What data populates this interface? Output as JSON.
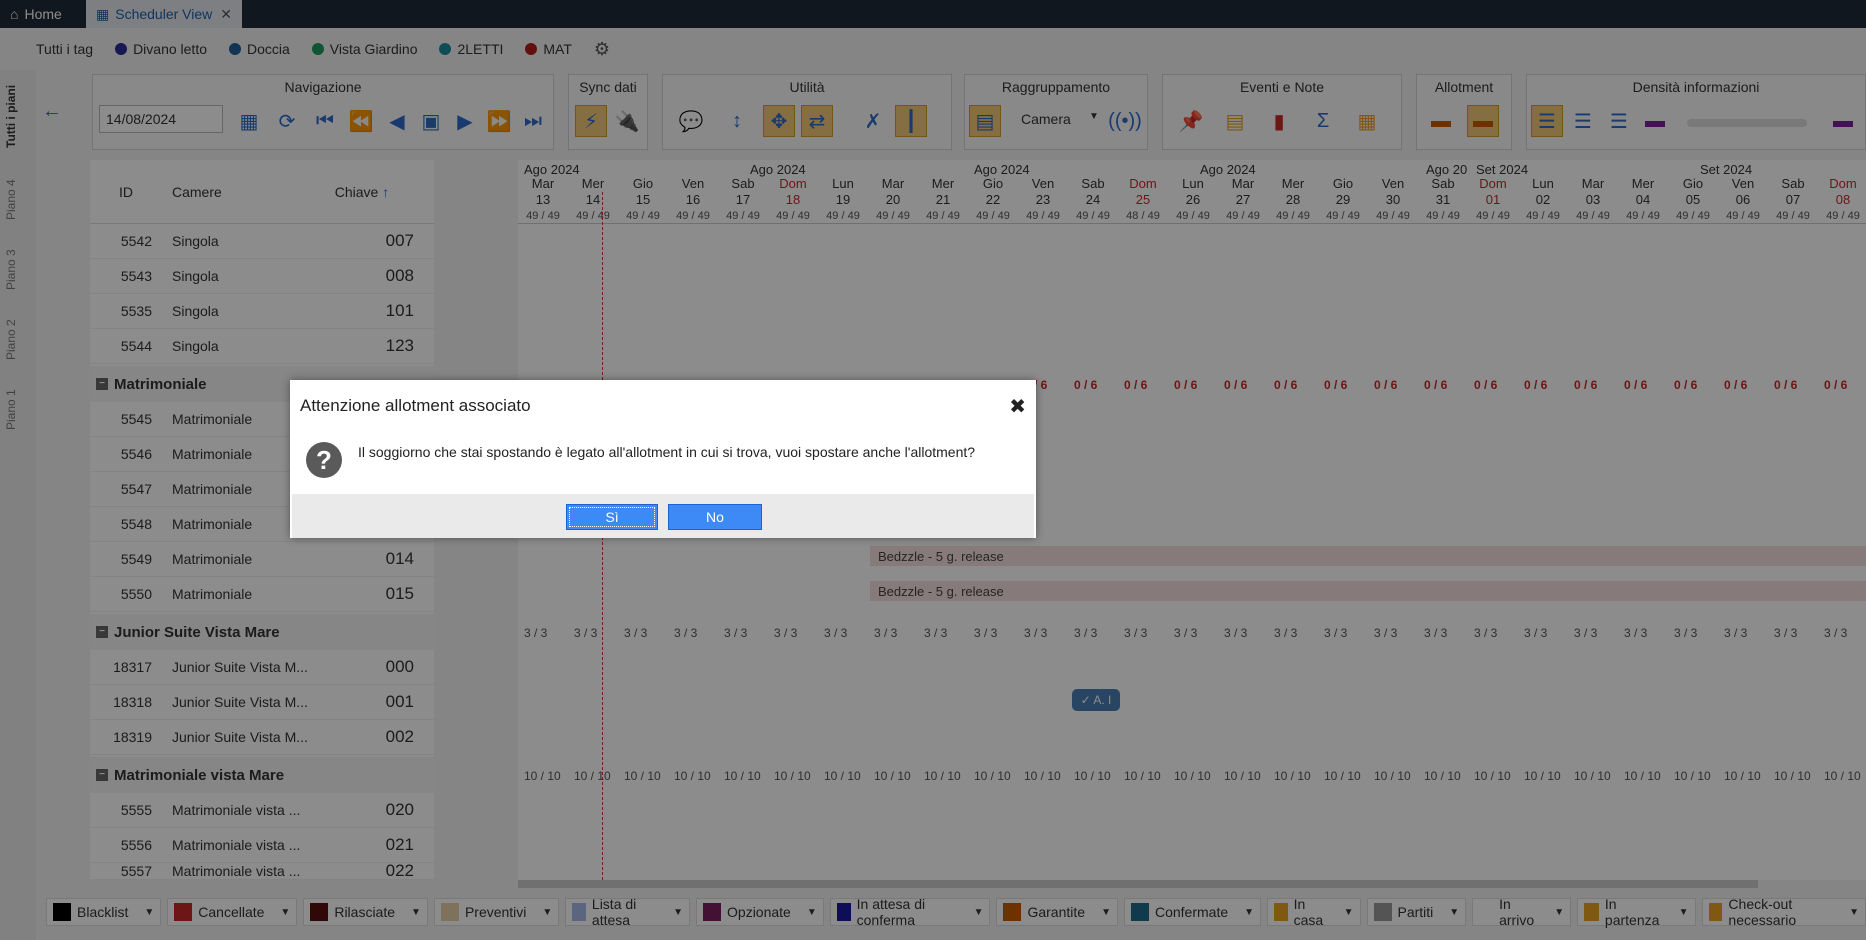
{
  "tabs": {
    "home": "Home",
    "scheduler": "Scheduler View"
  },
  "tags": [
    {
      "label": "Tutti i tag",
      "color": ""
    },
    {
      "label": "Divano letto",
      "color": "#2a2a9a"
    },
    {
      "label": "Doccia",
      "color": "#1f5f9a"
    },
    {
      "label": "Vista Giardino",
      "color": "#1f9a5f"
    },
    {
      "label": "2LETTI",
      "color": "#1f8a9a"
    },
    {
      "label": "MAT",
      "color": "#b71c1c"
    }
  ],
  "toolbar": {
    "navigazione": "Navigazione",
    "date": "14/08/2024",
    "sync": "Sync dati",
    "utilita": "Utilità",
    "raggruppamento": "Raggruppamento",
    "grouping_value": "Camera",
    "eventi": "Eventi e Note",
    "allotment": "Allotment",
    "densita": "Densità informazioni"
  },
  "sidebar": [
    "Tutti i piani",
    "Piano 4",
    "Piano 3",
    "Piano 2",
    "Piano 1"
  ],
  "columns": {
    "id": "ID",
    "camere": "Camere",
    "chiave": "Chiave"
  },
  "months": [
    "Ago 2024",
    "Ago 2024",
    "Ago 2024",
    "Ago 2024",
    "Ago 20",
    "Set 2024",
    "Set 2024"
  ],
  "days": [
    {
      "d": "Mar",
      "n": "13",
      "a": "49 / 49"
    },
    {
      "d": "Mer",
      "n": "14",
      "a": "49 / 49"
    },
    {
      "d": "Gio",
      "n": "15",
      "a": "49 / 49"
    },
    {
      "d": "Ven",
      "n": "16",
      "a": "49 / 49"
    },
    {
      "d": "Sab",
      "n": "17",
      "a": "49 / 49"
    },
    {
      "d": "Dom",
      "n": "18",
      "a": "49 / 49"
    },
    {
      "d": "Lun",
      "n": "19",
      "a": "49 / 49"
    },
    {
      "d": "Mar",
      "n": "20",
      "a": "49 / 49"
    },
    {
      "d": "Mer",
      "n": "21",
      "a": "49 / 49"
    },
    {
      "d": "Gio",
      "n": "22",
      "a": "49 / 49"
    },
    {
      "d": "Ven",
      "n": "23",
      "a": "49 / 49"
    },
    {
      "d": "Sab",
      "n": "24",
      "a": "49 / 49"
    },
    {
      "d": "Dom",
      "n": "25",
      "a": "48 / 49"
    },
    {
      "d": "Lun",
      "n": "26",
      "a": "49 / 49"
    },
    {
      "d": "Mar",
      "n": "27",
      "a": "49 / 49"
    },
    {
      "d": "Mer",
      "n": "28",
      "a": "49 / 49"
    },
    {
      "d": "Gio",
      "n": "29",
      "a": "49 / 49"
    },
    {
      "d": "Ven",
      "n": "30",
      "a": "49 / 49"
    },
    {
      "d": "Sab",
      "n": "31",
      "a": "49 / 49"
    },
    {
      "d": "Dom",
      "n": "01",
      "a": "49 / 49"
    },
    {
      "d": "Lun",
      "n": "02",
      "a": "49 / 49"
    },
    {
      "d": "Mar",
      "n": "03",
      "a": "49 / 49"
    },
    {
      "d": "Mer",
      "n": "04",
      "a": "49 / 49"
    },
    {
      "d": "Gio",
      "n": "05",
      "a": "49 / 49"
    },
    {
      "d": "Ven",
      "n": "06",
      "a": "49 / 49"
    },
    {
      "d": "Sab",
      "n": "07",
      "a": "49 / 49"
    },
    {
      "d": "Dom",
      "n": "08",
      "a": "49 / 49"
    }
  ],
  "rooms": {
    "singola": [
      {
        "id": "5542",
        "cam": "Singola",
        "key": "007"
      },
      {
        "id": "5543",
        "cam": "Singola",
        "key": "008"
      },
      {
        "id": "5535",
        "cam": "Singola",
        "key": "101"
      },
      {
        "id": "5544",
        "cam": "Singola",
        "key": "123"
      }
    ],
    "matrimoniale_title": "Matrimoniale",
    "matrimoniale": [
      {
        "id": "5545",
        "cam": "Matrimoniale",
        "key": ""
      },
      {
        "id": "5546",
        "cam": "Matrimoniale",
        "key": ""
      },
      {
        "id": "5547",
        "cam": "Matrimoniale",
        "key": ""
      },
      {
        "id": "5548",
        "cam": "Matrimoniale",
        "key": ""
      },
      {
        "id": "5549",
        "cam": "Matrimoniale",
        "key": "014"
      },
      {
        "id": "5550",
        "cam": "Matrimoniale",
        "key": "015"
      }
    ],
    "junior_title": "Junior Suite Vista Mare",
    "junior": [
      {
        "id": "18317",
        "cam": "Junior Suite Vista M...",
        "key": "000"
      },
      {
        "id": "18318",
        "cam": "Junior Suite Vista M...",
        "key": "001"
      },
      {
        "id": "18319",
        "cam": "Junior Suite Vista M...",
        "key": "002"
      }
    ],
    "vista_title": "Matrimoniale vista Mare",
    "vista": [
      {
        "id": "5555",
        "cam": "Matrimoniale vista ...",
        "key": "020"
      },
      {
        "id": "5556",
        "cam": "Matrimoniale vista ...",
        "key": "021"
      },
      {
        "id": "5557",
        "cam": "Matrimoniale vista ...",
        "key": "022"
      }
    ]
  },
  "counts": {
    "matrimoniale": "0 / 6",
    "junior": "3 / 3",
    "vista": "10 / 10"
  },
  "bookings": {
    "release": "Bedzzle - 5 g. release",
    "chip": "✓ A. I"
  },
  "legend": [
    {
      "label": "Blacklist",
      "color": "#000000"
    },
    {
      "label": "Cancellate",
      "color": "#c62828"
    },
    {
      "label": "Rilasciate",
      "color": "#5a0f0f"
    },
    {
      "label": "Preventivi",
      "color": "#e8cfa8"
    },
    {
      "label": "Lista di attesa",
      "color": "#a8b8e8"
    },
    {
      "label": "Opzionate",
      "color": "#7a1f5f"
    },
    {
      "label": "In attesa di conferma",
      "color": "#1a1aa0"
    },
    {
      "label": "Garantite",
      "color": "#c85a00"
    },
    {
      "label": "Confermate",
      "color": "#1f6a8a"
    },
    {
      "label": "In casa",
      "color": "#e8a020"
    },
    {
      "label": "Partiti",
      "color": "#9a9a9a"
    },
    {
      "label": "In arrivo",
      "color": "#ffffff"
    },
    {
      "label": "In partenza",
      "color": "#e8a020"
    },
    {
      "label": "Check-out necessario",
      "color": "#e8a020"
    }
  ],
  "dialog": {
    "title": "Attenzione allotment associato",
    "message": "Il soggiorno che stai spostando è legato all'allotment in cui si trova, vuoi spostare anche l'allotment?",
    "yes": "Sì",
    "no": "No"
  }
}
